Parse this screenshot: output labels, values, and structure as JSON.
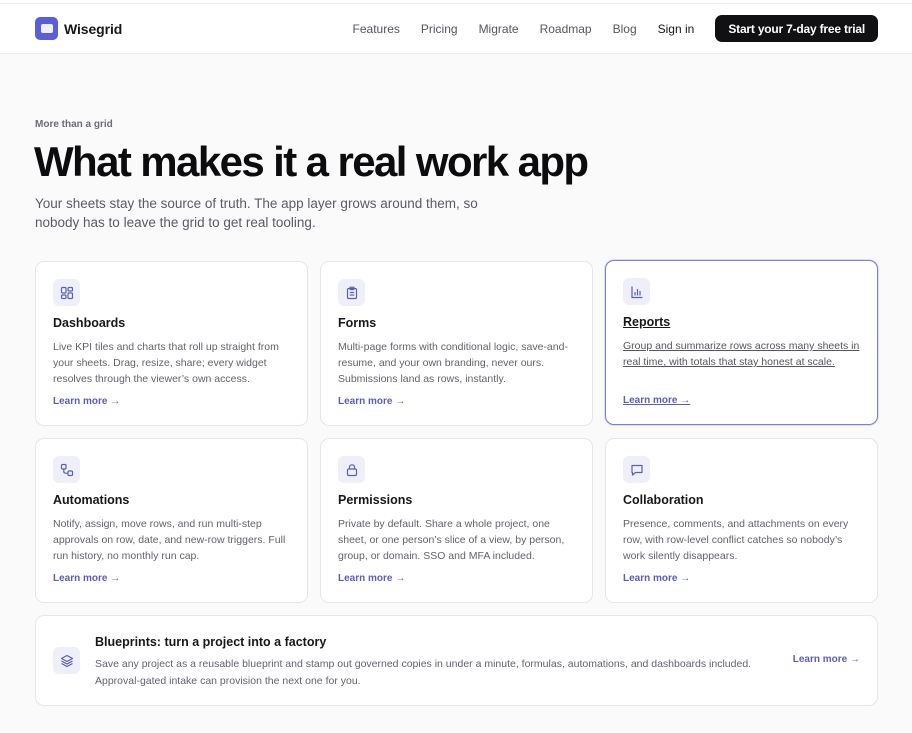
{
  "brand": {
    "name": "Wisegrid",
    "accent": "#5a5fd6"
  },
  "nav": {
    "links": [
      "Features",
      "Pricing",
      "Migrate",
      "Roadmap",
      "Blog"
    ],
    "sign_in": "Sign in",
    "cta": "Start your 7-day free trial"
  },
  "hero": {
    "eyebrow": "More than a grid",
    "title": "What makes it a real work app",
    "lead": "Your sheets stay the source of truth. The app layer grows around them, so nobody has to leave the grid to get real tooling."
  },
  "features": [
    {
      "icon": "grid-icon",
      "title": "Dashboards",
      "desc": "Live KPI tiles and charts that roll up straight from your sheets. Drag, resize, share; every widget resolves through the viewer’s own access.",
      "link": "Learn more →"
    },
    {
      "icon": "clipboard-icon",
      "title": "Forms",
      "desc": "Multi-page forms with conditional logic, save-and-resume, and your own branding, never ours. Submissions land as rows, instantly.",
      "link": "Learn more →"
    },
    {
      "icon": "bar-chart-icon",
      "title": "Reports",
      "desc": "Group and summarize rows across many sheets in real time, with totals that stay honest at scale.",
      "link": "Learn more →"
    },
    {
      "icon": "workflow-icon",
      "title": "Automations",
      "desc": "Notify, assign, move rows, and run multi-step approvals on row, date, and new-row triggers. Full run history, no monthly run cap.",
      "link": "Learn more →"
    },
    {
      "icon": "lock-icon",
      "title": "Permissions",
      "desc": "Private by default. Share a whole project, one sheet, or one person’s slice of a view, by person, group, or domain. SSO and MFA included.",
      "link": "Learn more →"
    },
    {
      "icon": "chat-icon",
      "title": "Collaboration",
      "desc": "Presence, comments, and attachments on every row, with row-level conflict catches so nobody’s work silently disappears.",
      "link": "Learn more →"
    }
  ],
  "blueprint": {
    "icon": "layers-icon",
    "title": "Blueprints: turn a project into a factory",
    "desc": "Save any project as a reusable blueprint and stamp out governed copies in under a minute, formulas, automations, and dashboards included. Approval-gated intake can provision the next one for you.",
    "link": "Learn more →"
  }
}
